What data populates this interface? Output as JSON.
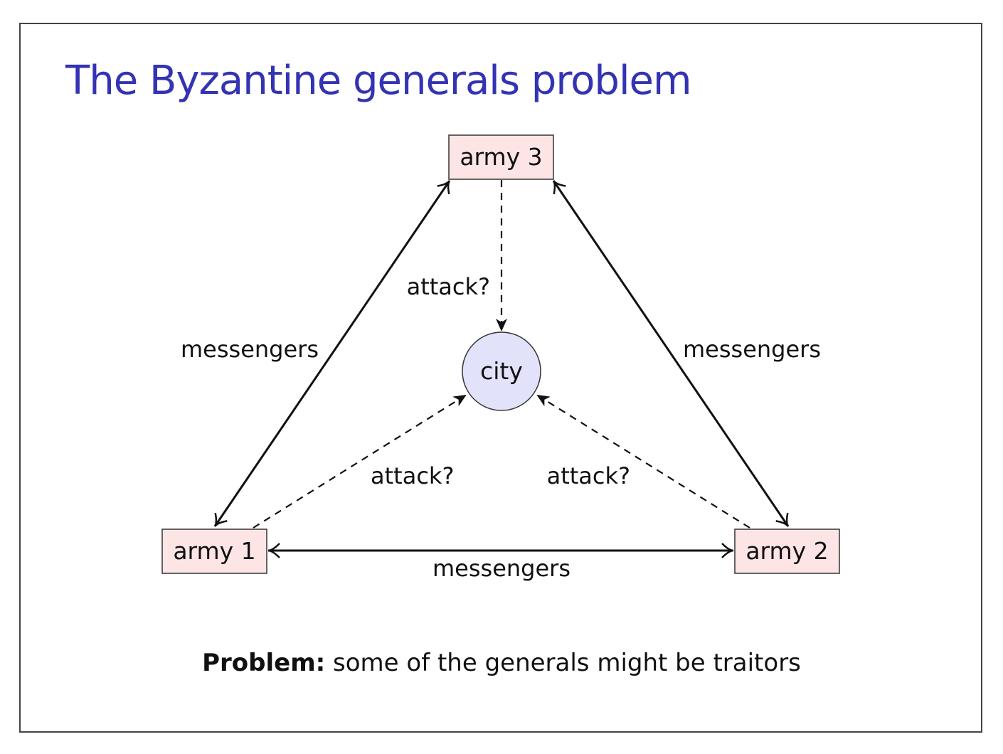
{
  "slide": {
    "title": "The Byzantine generals problem",
    "title_color": "#3333b3"
  },
  "diagram": {
    "nodes": {
      "army1": {
        "label": "army 1",
        "fill": "#fde5e5"
      },
      "army2": {
        "label": "army 2",
        "fill": "#fde5e5"
      },
      "army3": {
        "label": "army 3",
        "fill": "#fde5e5"
      },
      "city": {
        "label": "city",
        "fill": "#e2e2fb"
      }
    },
    "edges": {
      "army1_army3": {
        "label": "messengers",
        "style": "solid, double-headed"
      },
      "army3_army2": {
        "label": "messengers",
        "style": "solid, double-headed"
      },
      "army1_army2": {
        "label": "messengers",
        "style": "solid, double-headed"
      },
      "army3_city": {
        "label": "attack?",
        "style": "dashed, arrow to city"
      },
      "army1_city": {
        "label": "attack?",
        "style": "dashed, arrow to city"
      },
      "army2_city": {
        "label": "attack?",
        "style": "dashed, arrow to city"
      }
    }
  },
  "caption": {
    "bold": "Problem:",
    "text": " some of the generals might be traitors"
  }
}
